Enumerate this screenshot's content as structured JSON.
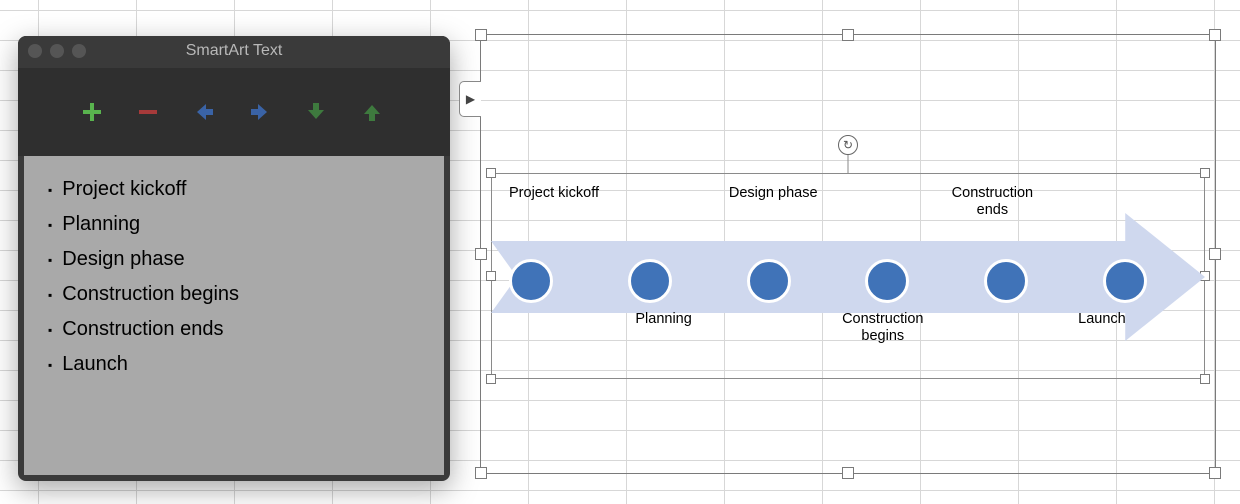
{
  "panel": {
    "title": "SmartArt Text",
    "items": [
      "Project kickoff",
      "Planning",
      "Design phase",
      "Construction begins",
      "Construction ends",
      "Launch"
    ]
  },
  "diagram": {
    "labels_top": [
      "Project kickoff",
      "",
      "Design phase",
      "",
      "Construction ends",
      ""
    ],
    "labels_bot": [
      "",
      "Planning",
      "",
      "Construction begins",
      "",
      "Launch"
    ]
  },
  "colors": {
    "arrow_fill": "#cfd8ee",
    "dot_fill": "#4073b8"
  }
}
